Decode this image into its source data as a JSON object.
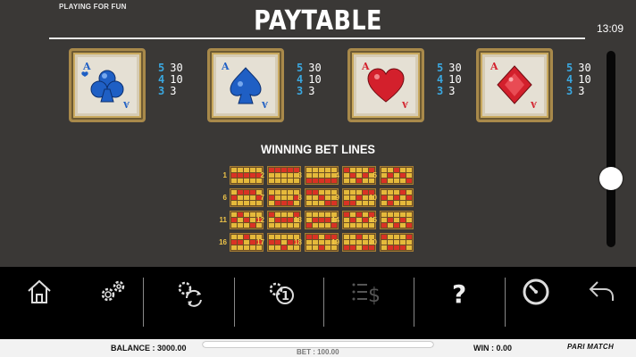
{
  "header": {
    "mode_label": "PLAYING FOR FUN",
    "title": "PAYTABLE",
    "clock": "13:09"
  },
  "symbols": [
    {
      "name": "club",
      "rank": "A",
      "color": "#1f5fc4",
      "pays": [
        {
          "count": "5",
          "value": "30"
        },
        {
          "count": "4",
          "value": "10"
        },
        {
          "count": "3",
          "value": "3"
        }
      ]
    },
    {
      "name": "spade",
      "rank": "A",
      "color": "#1f5fc4",
      "pays": [
        {
          "count": "5",
          "value": "30"
        },
        {
          "count": "4",
          "value": "10"
        },
        {
          "count": "3",
          "value": "3"
        }
      ]
    },
    {
      "name": "heart",
      "rank": "A",
      "color": "#d3202c",
      "pays": [
        {
          "count": "5",
          "value": "30"
        },
        {
          "count": "4",
          "value": "10"
        },
        {
          "count": "3",
          "value": "3"
        }
      ]
    },
    {
      "name": "diamond",
      "rank": "A",
      "color": "#d3202c",
      "pays": [
        {
          "count": "5",
          "value": "30"
        },
        {
          "count": "4",
          "value": "10"
        },
        {
          "count": "3",
          "value": "3"
        }
      ]
    }
  ],
  "bet_lines": {
    "title": "WINNING BET LINES",
    "lines": [
      {
        "num": "1",
        "rows": [
          1,
          1,
          1,
          1,
          1
        ]
      },
      {
        "num": "2",
        "rows": [
          0,
          0,
          0,
          0,
          0
        ]
      },
      {
        "num": "3",
        "rows": [
          2,
          2,
          2,
          2,
          2
        ]
      },
      {
        "num": "4",
        "rows": [
          0,
          1,
          2,
          1,
          0
        ]
      },
      {
        "num": "5",
        "rows": [
          2,
          1,
          0,
          1,
          2
        ]
      },
      {
        "num": "6",
        "rows": [
          1,
          0,
          0,
          0,
          1
        ]
      },
      {
        "num": "7",
        "rows": [
          1,
          2,
          2,
          2,
          1
        ]
      },
      {
        "num": "8",
        "rows": [
          0,
          0,
          1,
          2,
          2
        ]
      },
      {
        "num": "9",
        "rows": [
          2,
          2,
          1,
          0,
          0
        ]
      },
      {
        "num": "10",
        "rows": [
          1,
          2,
          1,
          0,
          1
        ]
      },
      {
        "num": "11",
        "rows": [
          1,
          0,
          1,
          2,
          1
        ]
      },
      {
        "num": "12",
        "rows": [
          0,
          1,
          1,
          1,
          0
        ]
      },
      {
        "num": "13",
        "rows": [
          2,
          1,
          1,
          1,
          2
        ]
      },
      {
        "num": "14",
        "rows": [
          0,
          1,
          0,
          1,
          0
        ]
      },
      {
        "num": "15",
        "rows": [
          2,
          1,
          2,
          1,
          2
        ]
      },
      {
        "num": "16",
        "rows": [
          1,
          1,
          0,
          1,
          1
        ]
      },
      {
        "num": "17",
        "rows": [
          1,
          1,
          2,
          1,
          1
        ]
      },
      {
        "num": "18",
        "rows": [
          0,
          0,
          2,
          0,
          0
        ]
      },
      {
        "num": "19",
        "rows": [
          2,
          2,
          0,
          2,
          2
        ]
      },
      {
        "num": "20",
        "rows": [
          0,
          2,
          2,
          2,
          0
        ]
      }
    ]
  },
  "slider": {
    "level": 0.65
  },
  "toolbar": {
    "items": [
      {
        "name": "home-button",
        "icon": "home-icon"
      },
      {
        "name": "settings-button",
        "icon": "gears-icon"
      },
      {
        "name": "autoplay-settings-button",
        "icon": "gear-refresh-icon"
      },
      {
        "name": "quick-settings-button",
        "icon": "gear-one-icon"
      },
      {
        "name": "bet-settings-button",
        "icon": "list-dollar-icon",
        "disabled": true
      },
      {
        "name": "help-button",
        "icon": "question-icon"
      },
      {
        "name": "history-button",
        "icon": "gauge-icon"
      },
      {
        "name": "back-button",
        "icon": "back-arrow-icon"
      }
    ]
  },
  "footer": {
    "balance": "BALANCE : 3000.00",
    "bet": "BET : 100.00",
    "win": "WIN : 0.00",
    "brand": "PARI MATCH"
  },
  "colors": {
    "background": "#3a3836",
    "pay_count": "#3aa8e0",
    "line_on": "#d93224",
    "line_off": "#e5b93b"
  }
}
